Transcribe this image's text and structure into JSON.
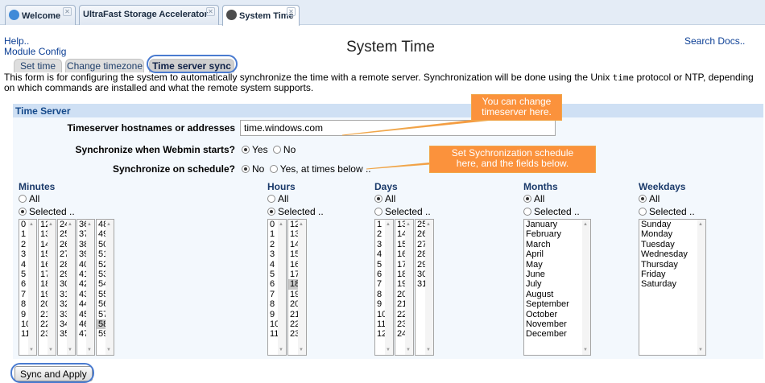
{
  "tabs": [
    {
      "label": "Welcome"
    },
    {
      "label": "UltraFast Storage Accelerator"
    },
    {
      "label": "System Time"
    }
  ],
  "links": {
    "help": "Help..",
    "module_config": "Module Config",
    "search_docs": "Search Docs.."
  },
  "page_title": "System Time",
  "subtabs": [
    {
      "label": "Set time"
    },
    {
      "label": "Change timezone"
    },
    {
      "label": "Time server sync"
    }
  ],
  "description": {
    "part1": "This form is for configuring the system to automatically synchronize the time with a remote server. Synchronization will be done using the Unix ",
    "code": "time",
    "part2": " protocol or NTP, depending on which commands are installed and what the remote system supports."
  },
  "section_title": "Time Server",
  "form": {
    "hostnames_label": "Timeserver hostnames or addresses",
    "hostnames_value": "time.windows.com",
    "sync_start_label": "Synchronize when Webmin starts?",
    "sync_start_yes": "Yes",
    "sync_start_no": "No",
    "sync_schedule_label": "Synchronize on schedule?",
    "sync_schedule_no": "No",
    "sync_schedule_yes": "Yes, at times below .."
  },
  "callouts": {
    "timeserver_l1": "You can change",
    "timeserver_l2": "timeserver here.",
    "schedule_l1": "Set Sychronization schedule",
    "schedule_l2": "here, and the fields below."
  },
  "schedule": {
    "all_label": "All",
    "selected_label": "Selected ..",
    "minutes": {
      "header": "Minutes",
      "mode": "selected",
      "selected_values": [
        "58"
      ]
    },
    "hours": {
      "header": "Hours",
      "mode": "selected",
      "selected_values": [
        "18"
      ]
    },
    "days": {
      "header": "Days",
      "mode": "all"
    },
    "months": {
      "header": "Months",
      "mode": "all",
      "options": [
        "January",
        "February",
        "March",
        "April",
        "May",
        "June",
        "July",
        "August",
        "September",
        "October",
        "November",
        "December"
      ]
    },
    "weekdays": {
      "header": "Weekdays",
      "mode": "all",
      "options": [
        "Sunday",
        "Monday",
        "Tuesday",
        "Wednesday",
        "Thursday",
        "Friday",
        "Saturday"
      ]
    }
  },
  "buttons": {
    "sync_apply": "Sync and Apply"
  },
  "colors": {
    "accent_ring": "#4a7bd0",
    "callout": "#fb923c",
    "section_header": "#cfe0f4"
  }
}
